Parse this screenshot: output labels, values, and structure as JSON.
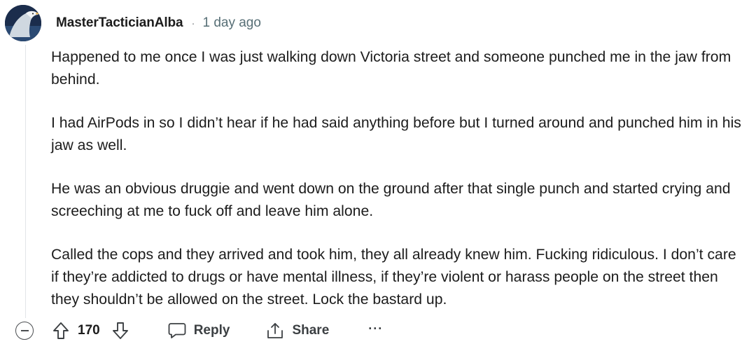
{
  "comment": {
    "username": "MasterTacticianAlba",
    "separator": "·",
    "timestamp": "1 day ago",
    "paragraphs": [
      "Happened to me once I was just walking down Victoria street and someone punched me in the jaw from behind.",
      "I had AirPods in so I didn’t hear if he had said anything before but I turned around and punched him in his jaw as well.",
      "He was an obvious druggie and went down on the ground after that single punch and started crying and screeching at me to fuck off and leave him alone.",
      "Called the cops and they arrived and took him, they all already knew him. Fucking ridiculous. I don’t care if they’re addicted to drugs or have mental illness, if they’re violent or harass people on the street then they shouldn’t be allowed on the street. Lock the bastard up."
    ],
    "score": "170"
  },
  "actions": {
    "reply_label": "Reply",
    "share_label": "Share",
    "more_label": "···"
  },
  "icons": {
    "collapse": "collapse-icon",
    "upvote": "upvote-arrow-icon",
    "downvote": "downvote-arrow-icon",
    "reply": "speech-bubble-icon",
    "share": "share-icon",
    "more": "ellipsis-icon"
  },
  "colors": {
    "text": "#1c1c1c",
    "meta": "#576f76",
    "action": "#3c4043",
    "thread_line": "#e2e5e8"
  }
}
